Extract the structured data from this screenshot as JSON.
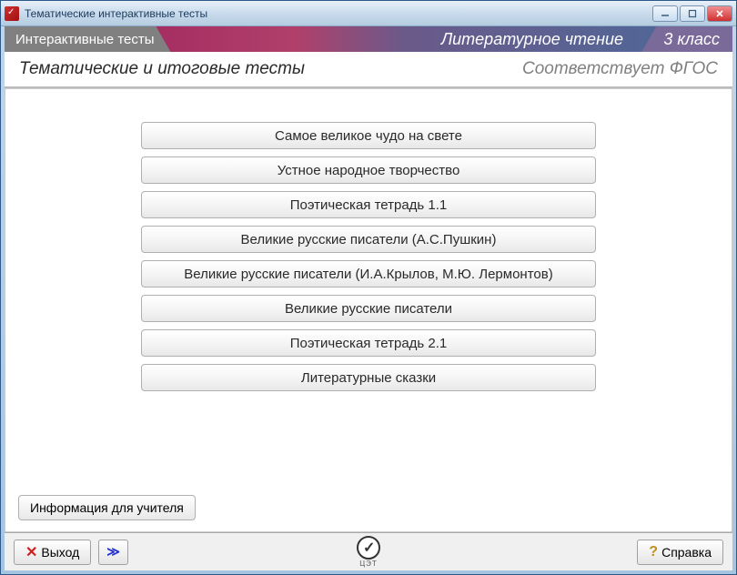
{
  "window": {
    "title": "Тематические интерактивные тесты"
  },
  "header": {
    "tab": "Интерактивные тесты",
    "subject": "Литературное чтение",
    "grade": "3 класс"
  },
  "subtitle": {
    "left": "Тематические и итоговые тесты",
    "right": "Соответствует ФГОС"
  },
  "menu": {
    "items": [
      "Самое великое чудо на свете",
      "Устное народное творчество",
      "Поэтическая тетрадь 1.1",
      "Великие русские писатели (А.С.Пушкин)",
      "Великие русские писатели (И.А.Крылов, М.Ю. Лермонтов)",
      "Великие русские писатели",
      "Поэтическая тетрадь 2.1",
      "Литературные сказки"
    ]
  },
  "teacher_info_label": "Информация для учителя",
  "footer": {
    "exit": "Выход",
    "help": "Справка",
    "logo_caption": "ЦЭТ"
  }
}
